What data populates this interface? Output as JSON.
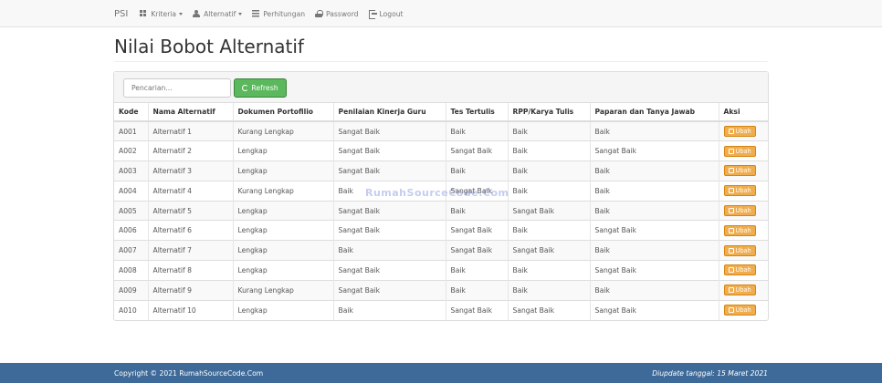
{
  "navbar": {
    "brand": "PSI",
    "items": [
      {
        "label": "Kriteria",
        "icon": "grid-icon",
        "dropdown": true
      },
      {
        "label": "Alternatif",
        "icon": "user-icon",
        "dropdown": true
      },
      {
        "label": "Perhitungan",
        "icon": "list-icon",
        "dropdown": false
      },
      {
        "label": "Password",
        "icon": "lock-icon",
        "dropdown": false
      },
      {
        "label": "Logout",
        "icon": "logout-icon",
        "dropdown": false
      }
    ]
  },
  "page": {
    "title": "Nilai Bobot Alternatif"
  },
  "toolbar": {
    "search_placeholder": "Pencarian...",
    "refresh_label": "Refresh"
  },
  "table": {
    "headers": [
      "Kode",
      "Nama Alternatif",
      "Dokumen Portofilio",
      "Penilaian Kinerja Guru",
      "Tes Tertulis",
      "RPP/Karya Tulis",
      "Paparan dan Tanya Jawab",
      "Aksi"
    ],
    "action_label": "Ubah",
    "rows": [
      [
        "A001",
        "Alternatif 1",
        "Kurang Lengkap",
        "Sangat Baik",
        "Baik",
        "Baik",
        "Baik"
      ],
      [
        "A002",
        "Alternatif 2",
        "Lengkap",
        "Sangat Baik",
        "Sangat Baik",
        "Baik",
        "Sangat Baik"
      ],
      [
        "A003",
        "Alternatif 3",
        "Lengkap",
        "Sangat Baik",
        "Baik",
        "Baik",
        "Baik"
      ],
      [
        "A004",
        "Alternatif 4",
        "Kurang Lengkap",
        "Baik",
        "Sangat Baik",
        "Baik",
        "Baik"
      ],
      [
        "A005",
        "Alternatif 5",
        "Lengkap",
        "Sangat Baik",
        "Baik",
        "Sangat Baik",
        "Baik"
      ],
      [
        "A006",
        "Alternatif 6",
        "Lengkap",
        "Sangat Baik",
        "Sangat Baik",
        "Baik",
        "Sangat Baik"
      ],
      [
        "A007",
        "Alternatif 7",
        "Lengkap",
        "Baik",
        "Sangat Baik",
        "Sangat Baik",
        "Baik"
      ],
      [
        "A008",
        "Alternatif 8",
        "Lengkap",
        "Sangat Baik",
        "Baik",
        "Baik",
        "Sangat Baik"
      ],
      [
        "A009",
        "Alternatif 9",
        "Kurang Lengkap",
        "Sangat Baik",
        "Baik",
        "Baik",
        "Baik"
      ],
      [
        "A010",
        "Alternatif 10",
        "Lengkap",
        "Baik",
        "Sangat Baik",
        "Sangat Baik",
        "Sangat Baik"
      ]
    ]
  },
  "watermark": "RumahSourceCode.Com",
  "footer": {
    "copyright": "Copyright © 2021 RumahSourceCode.Com",
    "updated": "Diupdate tanggal: 15 Maret 2021"
  },
  "colors": {
    "navbar_bg": "#f8f8f8",
    "refresh_button": "#5cb85c",
    "edit_button": "#f0ad4e",
    "footer_bg": "#3e6a99"
  }
}
